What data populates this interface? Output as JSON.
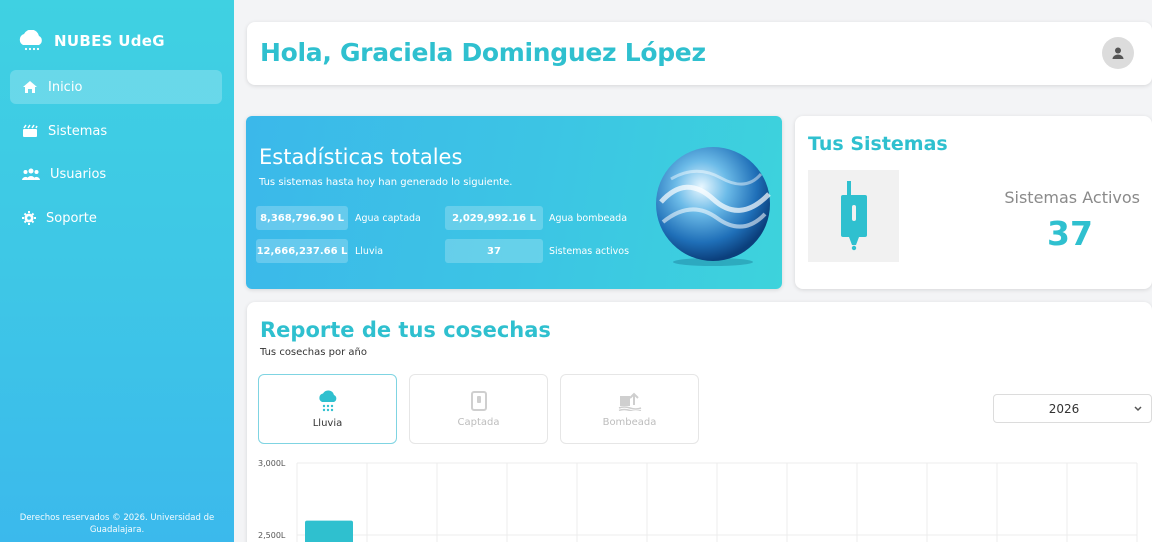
{
  "sidebar": {
    "brand": "NUBES UdeG",
    "items": [
      {
        "label": "Inicio",
        "icon": "home-icon",
        "active": true
      },
      {
        "label": "Sistemas",
        "icon": "systems-icon",
        "active": false
      },
      {
        "label": "Usuarios",
        "icon": "users-icon",
        "active": false
      },
      {
        "label": "Soporte",
        "icon": "gear-icon",
        "active": false
      }
    ],
    "copyright": "Derechos reservados © 2026. Universidad de Guadalajara."
  },
  "header": {
    "greeting": "Hola, Graciela Dominguez López",
    "avatar_icon": "user-icon"
  },
  "stats": {
    "title": "Estadísticas totales",
    "subtitle": "Tus sistemas hasta hoy han generado lo siguiente.",
    "items": [
      {
        "value": "8,368,796.90 L",
        "label": "Agua captada"
      },
      {
        "value": "2,029,992.16 L",
        "label": "Agua bombeada"
      },
      {
        "value": "12,666,237.66 L",
        "label": "Lluvia"
      },
      {
        "value": "37",
        "label": "Sistemas activos"
      }
    ]
  },
  "systems": {
    "title": "Tus Sistemas",
    "label": "Sistemas Activos",
    "count": "37",
    "device_icon": "water-collector-icon"
  },
  "report": {
    "title": "Reporte de tus cosechas",
    "subtitle": "Tus cosechas por año",
    "tabs": [
      {
        "label": "Lluvia",
        "icon": "rain-cloud-icon",
        "active": true
      },
      {
        "label": "Captada",
        "icon": "collector-icon",
        "active": false
      },
      {
        "label": "Bombeada",
        "icon": "pump-icon",
        "active": false
      }
    ],
    "year": "2026"
  },
  "colors": {
    "accent": "#2fc0cf",
    "sidebar_top": "#3fd1e2",
    "sidebar_bottom": "#3bb9ec"
  },
  "chart_data": {
    "type": "bar",
    "y_ticks": [
      "3,000L",
      "2,500L"
    ],
    "ylim": [
      2500,
      3000
    ],
    "series": [
      {
        "values": [
          2600
        ]
      }
    ],
    "grid": true
  }
}
